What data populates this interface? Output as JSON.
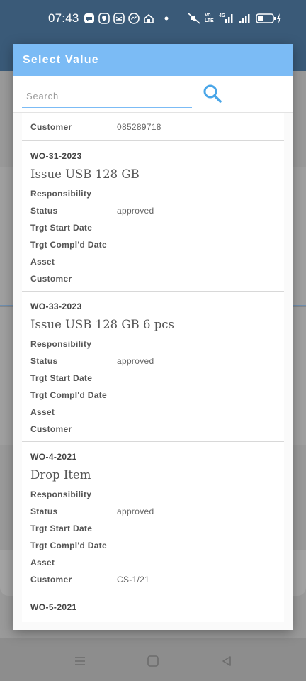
{
  "status_bar": {
    "time": "07:43",
    "network_label": "Vo LTE",
    "network_type": "4G",
    "notification_icons": [
      "message-icon",
      "maps-icon",
      "email-icon",
      "messenger-icon",
      "home-icon",
      "dot-icon"
    ]
  },
  "dialog": {
    "title": "Select Value",
    "search_placeholder": "Search",
    "search_value": ""
  },
  "partial_top": {
    "label": "Customer",
    "value": "085289718"
  },
  "labels": {
    "responsibility": "Responsibility",
    "status": "Status",
    "start": "Trgt Start Date",
    "compl": "Trgt Compl'd Date",
    "asset": "Asset",
    "customer": "Customer"
  },
  "items": [
    {
      "id": "WO-31-2023",
      "title": "Issue USB 128 GB",
      "responsibility": "",
      "status": "approved",
      "start": "",
      "compl": "",
      "asset": "",
      "customer": ""
    },
    {
      "id": "WO-33-2023",
      "title": "Issue USB 128 GB 6 pcs",
      "responsibility": "",
      "status": "approved",
      "start": "",
      "compl": "",
      "asset": "",
      "customer": ""
    },
    {
      "id": "WO-4-2021",
      "title": "Drop Item",
      "responsibility": "",
      "status": "approved",
      "start": "",
      "compl": "",
      "asset": "",
      "customer": "CS-1/21"
    }
  ],
  "partial_bottom": {
    "id": "WO-5-2021"
  },
  "colors": {
    "header": "#7bbbf5",
    "accent": "#4aa6e8"
  }
}
